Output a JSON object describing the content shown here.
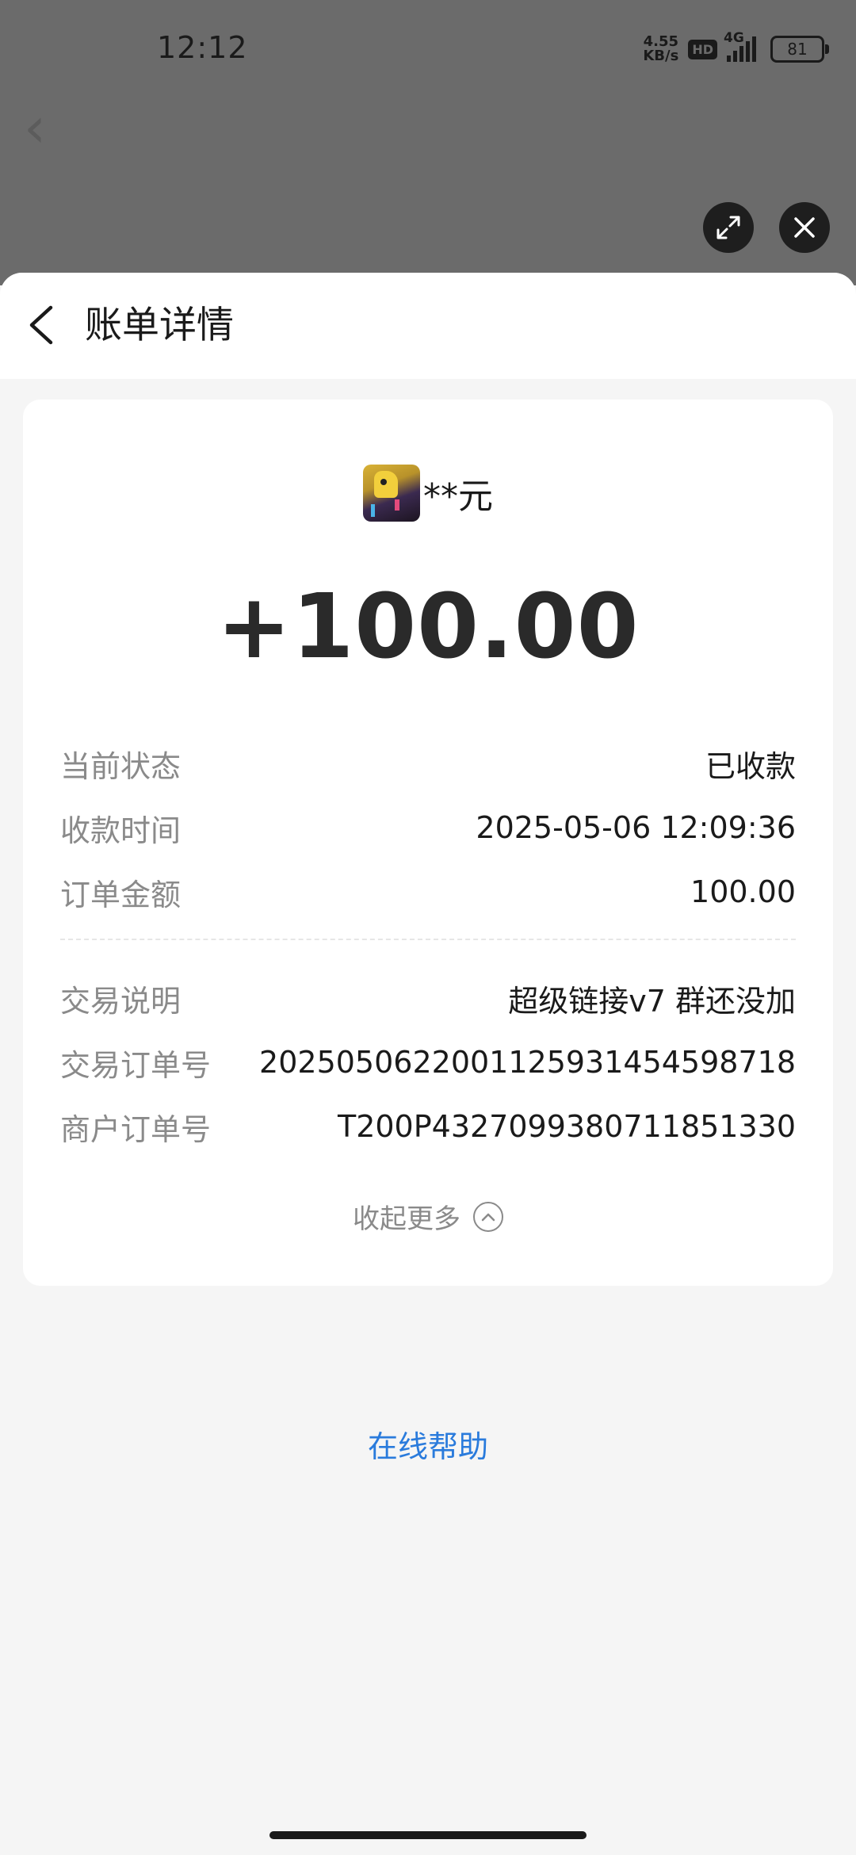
{
  "status_bar": {
    "time": "12:12",
    "net_speed_top": "4.55",
    "net_speed_bottom": "KB/s",
    "hd_badge": "HD",
    "network_type": "4G",
    "battery": "81"
  },
  "overlay": {
    "expand_icon": "expand-icon",
    "close_icon": "close-icon"
  },
  "header": {
    "back_icon": "chevron-left-icon",
    "title": "账单详情"
  },
  "payer": {
    "name": "**元"
  },
  "amount": "+100.00",
  "details": [
    {
      "label": "当前状态",
      "value": "已收款"
    },
    {
      "label": "收款时间",
      "value": "2025-05-06 12:09:36"
    },
    {
      "label": "订单金额",
      "value": "100.00"
    }
  ],
  "details_more": [
    {
      "label": "交易说明",
      "value": "超级链接v7 群还没加"
    },
    {
      "label": "交易订单号",
      "value": "2025050622001125931454598718"
    },
    {
      "label": "商户订单号",
      "value": "T200P4327099380711851330"
    }
  ],
  "collapse": {
    "label": "收起更多",
    "icon": "chevron-up-circle-icon"
  },
  "help_link": "在线帮助",
  "colors": {
    "backdrop": "#6b6b6b",
    "link": "#2a7bdc",
    "label": "#8a8a8a",
    "text": "#1a1a1a"
  }
}
